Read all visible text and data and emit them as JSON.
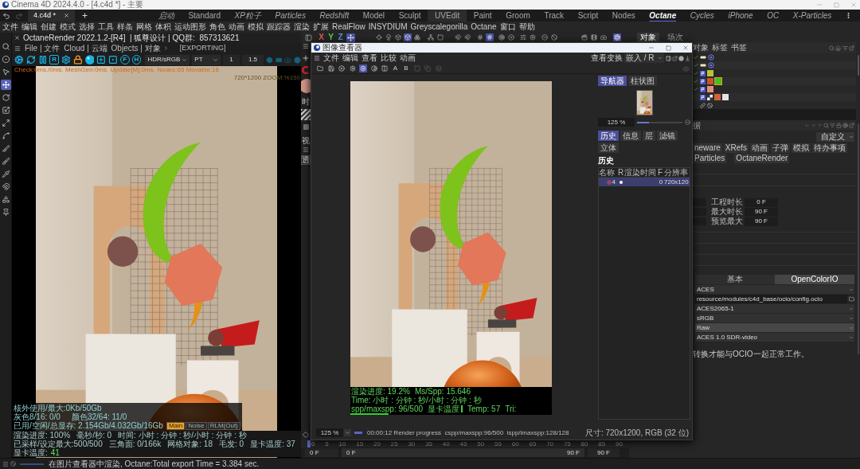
{
  "title_bar": {
    "title": "Cinema 4D 2024.4.0 - [4.c4d *] - 主要"
  },
  "doc_tabs": [
    {
      "label": "4.c4d *",
      "selected": true
    }
  ],
  "layouts": [
    {
      "label": "启动",
      "italic": true,
      "selected": false,
      "highlighted": false
    },
    {
      "label": "Standard",
      "italic": false,
      "selected": false,
      "highlighted": false
    },
    {
      "label": "XP粒子",
      "italic": true,
      "selected": false,
      "highlighted": false
    },
    {
      "label": "Particles",
      "italic": true,
      "selected": false,
      "highlighted": false
    },
    {
      "label": "Redshift",
      "italic": true,
      "selected": false,
      "highlighted": false
    },
    {
      "label": "Model",
      "italic": false,
      "selected": false,
      "highlighted": false
    },
    {
      "label": "Sculpt",
      "italic": false,
      "selected": false,
      "highlighted": false
    },
    {
      "label": "UVEdit",
      "italic": false,
      "selected": false,
      "highlighted": true
    },
    {
      "label": "Paint",
      "italic": false,
      "selected": false,
      "highlighted": false
    },
    {
      "label": "Groom",
      "italic": false,
      "selected": false,
      "highlighted": false
    },
    {
      "label": "Track",
      "italic": false,
      "selected": false,
      "highlighted": false
    },
    {
      "label": "Script",
      "italic": false,
      "selected": false,
      "highlighted": false
    },
    {
      "label": "Nodes",
      "italic": false,
      "selected": false,
      "highlighted": false
    },
    {
      "label": "Octane",
      "italic": true,
      "selected": true,
      "highlighted": false
    },
    {
      "label": "Cycles",
      "italic": true,
      "selected": false,
      "highlighted": false
    },
    {
      "label": "iPhone",
      "italic": true,
      "selected": false,
      "highlighted": false
    },
    {
      "label": "OC",
      "italic": true,
      "selected": false,
      "highlighted": false
    },
    {
      "label": "X-Particles",
      "italic": true,
      "selected": false,
      "highlighted": false
    }
  ],
  "main_menu": [
    "文件",
    "编辑",
    "创建",
    "模式",
    "选择",
    "工具",
    "样条",
    "网格",
    "体积",
    "运动图形",
    "角色",
    "动画",
    "模拟",
    "跟踪器",
    "渲染",
    "扩展",
    "RealFlow",
    "INSYDIUM",
    "Greyscalegorilla",
    "Octane",
    "窗口",
    "帮助"
  ],
  "tools": [
    {
      "kind": "search",
      "selected": false
    },
    {
      "kind": "select",
      "selected": false
    },
    {
      "kind": "pointer",
      "selected": false
    },
    {
      "kind": "move",
      "selected": true
    },
    {
      "kind": "rotate",
      "selected": false
    },
    {
      "kind": "scale",
      "selected": false
    },
    {
      "kind": "transform",
      "selected": false
    },
    {
      "kind": "spline",
      "selected": false
    },
    {
      "kind": "knife",
      "selected": false
    },
    {
      "kind": "brush",
      "selected": false
    },
    {
      "kind": "pipette",
      "selected": false
    },
    {
      "kind": "magnet",
      "selected": false
    },
    {
      "kind": "shapes",
      "selected": false
    },
    {
      "kind": "pin",
      "selected": false
    }
  ],
  "octane": {
    "title": "OctaneRender 2022.1.2-[R4]  | 狐尊设计 | QQ群:  857313621",
    "menu": [
      "File | 文件",
      "Cloud | 云端",
      "Objects | 对象"
    ],
    "status": "[EXPORTING]",
    "letters": [
      "R",
      "F",
      "H"
    ],
    "locked": true,
    "tonemap": "HDR/sRGB",
    "kernel": "PT",
    "value_1": "1",
    "value_2": "1.5",
    "stats": "Check:0ms./0ms. MeshGen:0ms. Update[M]:0ms. Nodes:65 Movable:16",
    "zoom_info": "720*1200 ZOOM:%150",
    "gpu_stats": [
      [
        "核外使用/最大:0Kb/50Gb"
      ],
      [
        "灰色8/16: 0/0",
        "颜色32/64: 11/0"
      ],
      [
        "已用/空闲/总显存: 2.154Gb/4.032Gb/16Gb"
      ]
    ],
    "passes": [
      {
        "label": "Main",
        "selected": true
      },
      {
        "label": "Noise",
        "selected": false
      },
      {
        "label": "RLM(Out)",
        "selected": false
      }
    ],
    "progress_items": [
      "渲染进度: 100%",
      "毫秒/秒: 0",
      "时间: 小时 : 分钟 : 秒/小时 : 分钟 : 秒",
      "已采样/设定最大:500/500",
      "三角面: 0/166k",
      "网格对象: 18",
      "毛发: 0",
      "显卡温度: 37",
      "显卡温度:"
    ],
    "temperature": "41"
  },
  "viewport_toolbar": {
    "axes": [
      {
        "label": "X",
        "color": "#e05a5a"
      },
      {
        "label": "Y",
        "color": "#5ccf5c"
      },
      {
        "label": "Z",
        "color": "#5a8ee0"
      }
    ],
    "axis_tool": {
      "selected": true
    },
    "groups": [
      [
        {
          "kind": "locate",
          "selected": false
        },
        {
          "kind": "lamp",
          "selected": false
        },
        {
          "kind": "box",
          "selected": false
        },
        {
          "kind": "box",
          "selected": true
        },
        {
          "kind": "boxes",
          "selected": false
        }
      ],
      [
        {
          "kind": "network",
          "selected": false
        },
        {
          "kind": "square",
          "selected": false
        }
      ],
      [
        {
          "kind": "magnet",
          "selected": false
        },
        {
          "kind": "magnet",
          "selected": false
        }
      ],
      [
        {
          "kind": "grid",
          "selected": false
        },
        {
          "kind": "grid",
          "selected": true
        }
      ],
      [
        {
          "kind": "target",
          "selected": false
        },
        {
          "kind": "disc",
          "selected": false
        }
      ],
      [
        {
          "kind": "sliders",
          "selected": false
        },
        {
          "kind": "gear",
          "selected": false
        }
      ],
      [
        {
          "kind": "minus",
          "selected": false
        },
        {
          "kind": "ban",
          "selected": false
        }
      ],
      [
        {
          "kind": "clapper",
          "selected": false
        },
        {
          "kind": "film",
          "selected": false
        },
        {
          "kind": "camera",
          "selected": false
        }
      ],
      [
        {
          "kind": "aperture",
          "selected": true
        }
      ]
    ]
  },
  "side_strip": {
    "labels": [
      "时",
      "视",
      "透"
    ]
  },
  "manager_tabs": [
    {
      "label": "对象",
      "selected": true
    },
    {
      "label": "场次",
      "selected": false
    }
  ],
  "viewer": {
    "title": "图像查看器",
    "menu": [
      "文件",
      "编辑",
      "查看",
      "比较",
      "动画"
    ],
    "view_transform_label": "查看变换",
    "view_transform": "嵌入 / R",
    "tools": [
      {
        "kind": "folder",
        "disabled": false,
        "selected": false
      },
      {
        "kind": "save",
        "disabled": false,
        "selected": false
      },
      {
        "kind": "stop",
        "disabled": false,
        "selected": false
      },
      {
        "kind": "gear",
        "disabled": false,
        "selected": false
      },
      {
        "kind": "gear",
        "disabled": false,
        "selected": true
      },
      {
        "kind": "contrast",
        "disabled": false,
        "selected": false
      },
      {
        "kind": "split",
        "disabled": false,
        "selected": false
      },
      {
        "kind": "letter",
        "label": "A",
        "disabled": false,
        "selected": false
      },
      {
        "kind": "letter",
        "label": "B",
        "disabled": false,
        "selected": false
      },
      {
        "kind": "frame",
        "disabled": true,
        "selected": false
      },
      {
        "kind": "copy",
        "disabled": true,
        "selected": false
      },
      {
        "kind": "layers",
        "disabled": true,
        "selected": false
      }
    ],
    "extra_tool": {
      "disabled": true
    },
    "stamp_items": [
      {
        "kind": "text",
        "text": "渲染进度: 19.2%"
      },
      {
        "kind": "text",
        "text": "Ms/Spp: 15.646"
      },
      {
        "kind": "text",
        "text": "Time: 小时 : 分钟 : 秒/小时 : 分钟 : 秒"
      },
      {
        "kind": "text",
        "text": "spp/maxspp: 96/500"
      },
      {
        "kind": "text",
        "text": "显卡温度"
      },
      {
        "kind": "meter"
      },
      {
        "kind": "text",
        "text": "Temp: 57"
      },
      {
        "kind": "text",
        "text": "Tri:"
      }
    ],
    "stamp_progress": {
      "level": 0.19
    },
    "nav_tabs": [
      {
        "label": "导航器",
        "selected": true
      },
      {
        "label": "柱状图",
        "selected": false
      }
    ],
    "zoom": {
      "value": "125 %",
      "level": 0.26
    },
    "info_tabs": [
      {
        "label": "历史",
        "selected": true
      },
      {
        "label": "信息",
        "selected": false
      },
      {
        "label": "层",
        "selected": false
      },
      {
        "label": "滤镜",
        "selected": false
      },
      {
        "label": "立体",
        "selected": false
      }
    ],
    "history": {
      "title": "历史",
      "columns": [
        "名称",
        "R",
        "渲染时间",
        "F",
        "分辨率"
      ],
      "rows": [
        {
          "name": "4",
          "rendered": true,
          "frame": "0",
          "resolution": "720x120",
          "selected": true
        }
      ]
    },
    "status": {
      "zoom": "125 %",
      "progress": "00:00:12 Render progress  cspp/maxspp:96/500  ispp/imaxspp:128/128",
      "size": "尺寸: 720x1200, RGB (32 位)"
    }
  },
  "timeline": {
    "ticks": [
      "0",
      "5",
      "10",
      "15",
      "20",
      "25",
      "30",
      "35",
      "40",
      "45",
      "50",
      "55",
      "60",
      "65",
      "70",
      "75",
      "80",
      "85",
      "90"
    ],
    "start": "0 F",
    "range_start": "0 F",
    "range_end": "90 F",
    "end": "90 F"
  },
  "object_manager": {
    "tabs": [
      "对象",
      "标签",
      "书签"
    ],
    "rows": [
      {
        "checked": true,
        "tags": [
          {
            "kind": "display",
            "selected": false
          },
          {
            "kind": "target",
            "selected": false
          }
        ]
      },
      {
        "checked": true,
        "tags": [
          {
            "kind": "display",
            "selected": false
          },
          {
            "kind": "target",
            "selected": false
          }
        ]
      },
      {
        "checked": true,
        "tags": [
          {
            "kind": "flag",
            "selected": false
          },
          {
            "kind": "material",
            "color": "#b9c23c",
            "selected": false
          }
        ]
      },
      {
        "checked": true,
        "tags": [
          {
            "kind": "flag",
            "selected": false
          },
          {
            "kind": "material",
            "color": "#c4552c",
            "selected": false
          },
          {
            "kind": "material",
            "color": "#3fc21e",
            "selected": true
          }
        ]
      },
      {
        "checked": true,
        "tags": [
          {
            "kind": "flag",
            "selected": false
          },
          {
            "kind": "material",
            "color": "#e09080",
            "selected": false
          }
        ]
      },
      {
        "checked": false,
        "tags": [
          {
            "kind": "flag",
            "selected": false
          },
          {
            "kind": "checker",
            "selected": false
          },
          {
            "kind": "material",
            "color": "#d0603a",
            "selected": false
          },
          {
            "kind": "material",
            "color": "#e4e4e4",
            "selected": false
          }
        ]
      },
      {
        "checked": false,
        "tags": [
          {
            "kind": "link",
            "selected": false
          },
          {
            "kind": "ban",
            "selected": false
          }
        ]
      }
    ]
  },
  "attributes": {
    "title": "据",
    "mode": "自定义",
    "tab_rows": [
      [
        "neware",
        "XRefs",
        "动画",
        "子弹",
        "模拟",
        "待办事项"
      ],
      [
        "Particles",
        "OctaneRender"
      ]
    ],
    "fields": [
      {
        "label": "工程时长",
        "value": "0 F"
      },
      {
        "label": "最大时长",
        "value": "90 F"
      },
      {
        "label": "预览最大",
        "value": "90 F"
      }
    ],
    "ocio_tabs": [
      {
        "label": "基本",
        "selected": false
      },
      {
        "label": "OpenColorIO",
        "selected": true
      }
    ],
    "ocio_rows": [
      {
        "kind": "dropdown",
        "value": "ACES",
        "highlighted": false
      },
      {
        "kind": "path",
        "value": "resource/modules/c4d_base/ocio/config.ocio",
        "highlighted": false
      },
      {
        "kind": "dropdown",
        "value": "ACES2065-1",
        "highlighted": false
      },
      {
        "kind": "dropdown",
        "value": "sRGB",
        "highlighted": false
      },
      {
        "kind": "dropdown",
        "value": "Raw",
        "highlighted": true
      },
      {
        "kind": "dropdown",
        "value": "ACES 1.0 SDR-video",
        "highlighted": false
      }
    ],
    "note": "转换才能与OCIO一起正常工作。"
  },
  "status_bar": {
    "message": "在图片查看器中渲染, Octane:Total export Time = 3.384 sec."
  }
}
